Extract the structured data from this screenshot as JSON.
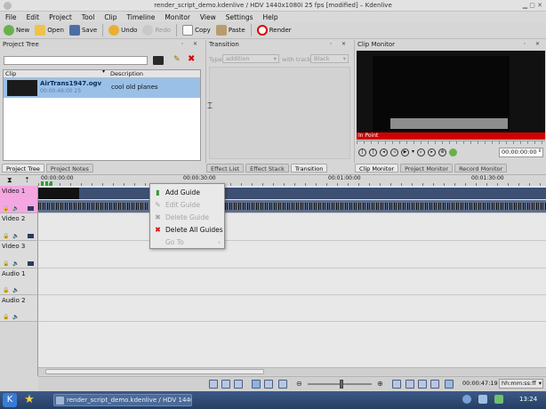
{
  "window": {
    "title": "render_script_demo.kdenlive / HDV 1440x1080i 25 fps [modified] – Kdenlive"
  },
  "menu": [
    "File",
    "Edit",
    "Project",
    "Tool",
    "Clip",
    "Timeline",
    "Monitor",
    "View",
    "Settings",
    "Help"
  ],
  "toolbar": {
    "new": "New",
    "open": "Open",
    "save": "Save",
    "undo": "Undo",
    "redo": "Redo",
    "copy": "Copy",
    "paste": "Paste",
    "render": "Render"
  },
  "project_tree": {
    "title": "Project Tree",
    "col_clip": "Clip",
    "col_description": "Description",
    "clip_name": "AirTrans1947.ogv",
    "clip_meta": "00:00:46:00 25",
    "clip_description": "cool old planes"
  },
  "transition": {
    "title": "Transition",
    "type_label": "Type",
    "type_value": "addition",
    "with_track_label": "with track",
    "with_track_value": "Black"
  },
  "clip_monitor": {
    "title": "Clip Monitor",
    "in_point": "In Point",
    "timecode": "00:00:00:00"
  },
  "left_tabs": [
    "Project Tree",
    "Project Notes"
  ],
  "mid_tabs": [
    "Effect List",
    "Effect Stack",
    "Transition"
  ],
  "right_tabs": [
    "Clip Monitor",
    "Project Monitor",
    "Record Monitor"
  ],
  "ruler": [
    "00:00:00:00",
    "00:00:30:00",
    "00:01:00:00",
    "00:01:30:00"
  ],
  "tracks": [
    "Video 1",
    "Video 2",
    "Video 3",
    "Audio 1",
    "Audio 2"
  ],
  "context_menu": {
    "add_guide": "Add Guide",
    "edit_guide": "Edit Guide",
    "delete_guide": "Delete Guide",
    "delete_all_guides": "Delete All Guides",
    "go_to": "Go To"
  },
  "status": {
    "timecode": "00:00:47:19",
    "format": "hh:mm:ss:ff"
  },
  "taskbar": {
    "task": "render_script_demo.kdenlive / HDV 1440x",
    "clock": "13:24"
  },
  "colors": {
    "accent": "#3d7ec9",
    "selection": "#9ac0e8",
    "red_bar": "#d10000",
    "video_track": "#f4a6e0"
  }
}
